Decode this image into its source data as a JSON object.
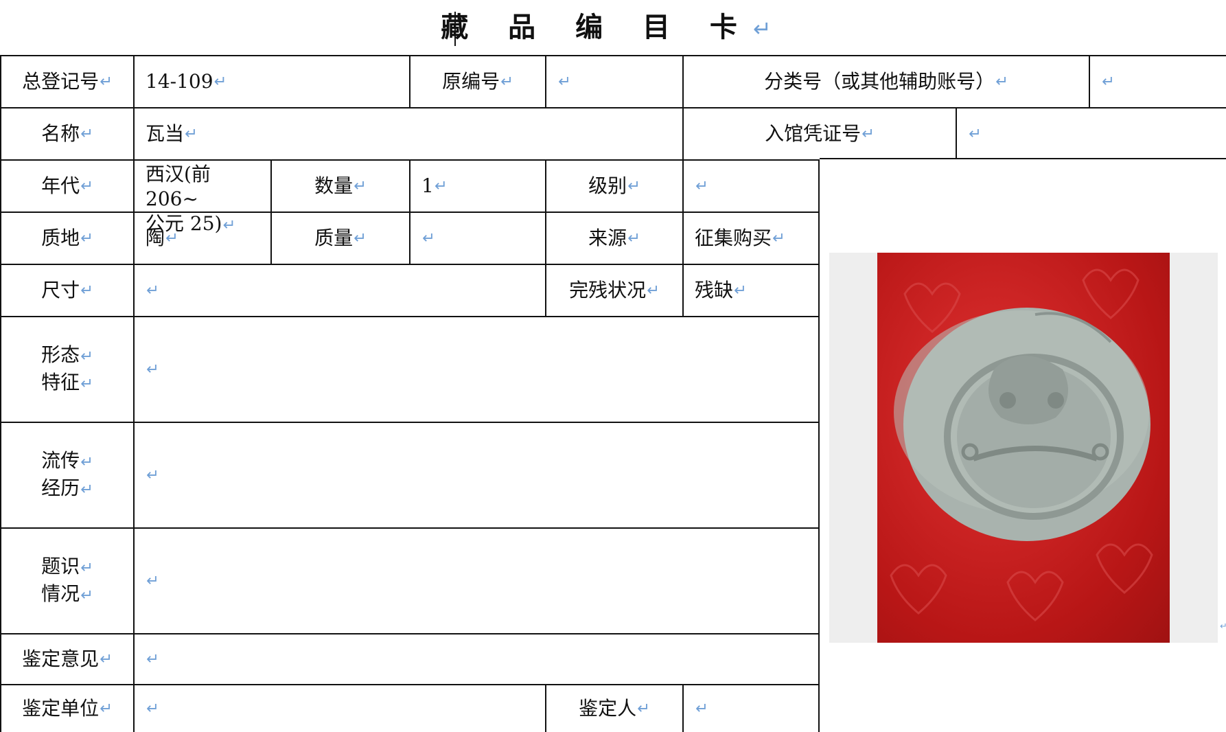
{
  "card": {
    "title": "藏 品 编 目 卡",
    "return_mark": "↵"
  },
  "row1": {
    "reg_label": "总登记号",
    "reg_value": "14-109",
    "orig_label": "原编号",
    "orig_value": "",
    "class_label": "分类号（或其他辅助账号）",
    "class_value": ""
  },
  "row2": {
    "name_label": "名称",
    "name_value": "瓦当",
    "voucher_label": "入馆凭证号",
    "voucher_value": ""
  },
  "row3": {
    "era_label": "年代",
    "era_line1": "西汉(前 206~",
    "era_line2": "公元 25)",
    "qty_label": "数量",
    "qty_value": "1",
    "grade_label": "级别",
    "grade_value": ""
  },
  "row4": {
    "material_label": "质地",
    "material_value": "陶",
    "weight_label": "质量",
    "weight_value": "",
    "source_label": "来源",
    "source_value": "征集购买"
  },
  "row5": {
    "size_label": "尺寸",
    "size_value": "",
    "condition_label": "完残状况",
    "condition_value": "残缺"
  },
  "row6": {
    "label_line1": "形态",
    "label_line2": "特征",
    "value": ""
  },
  "row7": {
    "label_line1": "流传",
    "label_line2": "经历",
    "value": ""
  },
  "row8": {
    "label_line1": "题识",
    "label_line2": "情况",
    "value": ""
  },
  "row9": {
    "label": "鉴定意见",
    "value": ""
  },
  "row10": {
    "unit_label": "鉴定单位",
    "unit_value": "",
    "person_label": "鉴定人",
    "person_value": ""
  },
  "photo": {
    "background_color": "#c81e1e",
    "object_color": "#a9b3ae"
  }
}
